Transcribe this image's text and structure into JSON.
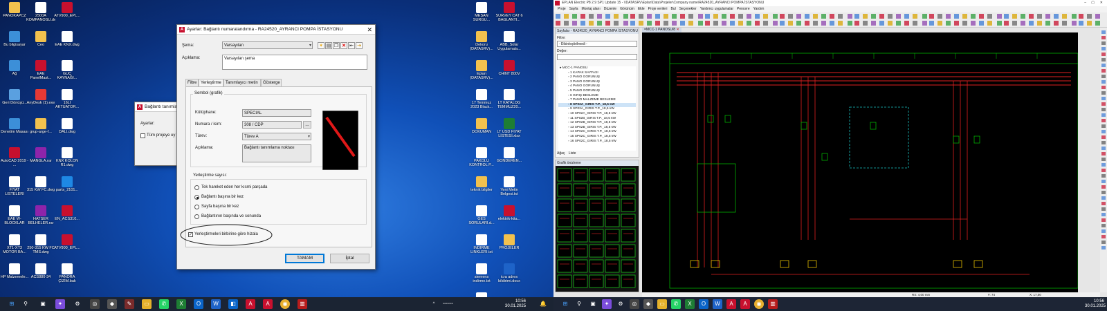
{
  "desktop_left": {
    "icons": [
      {
        "label": "PANOKAPCZ",
        "color": "#f2c14e"
      },
      {
        "label": "2500A KOMPANOSU.dwg",
        "color": "#ffffff"
      },
      {
        "label": "ATV900_EPL...",
        "color": "#c8102e"
      },
      {
        "label": "Bu bilgisayar",
        "color": "#3c8fd8"
      },
      {
        "label": "Ceo",
        "color": "#f2c14e"
      },
      {
        "label": "EAE KNX.dwg",
        "color": "#ffffff"
      },
      {
        "label": "Ağ",
        "color": "#3c8fd8"
      },
      {
        "label": "EAE PanelMast...",
        "color": "#c8102e"
      },
      {
        "label": "GÜÇ KAYNAĞI...",
        "color": "#ffffff"
      },
      {
        "label": "Geri Dönüşü...",
        "color": "#5aa0e0"
      },
      {
        "label": "AnyDesk (1).exe",
        "color": "#e53935"
      },
      {
        "label": "16LI AKTUATOR...",
        "color": "#ffffff"
      },
      {
        "label": "Denetim Masası",
        "color": "#3c8fd8"
      },
      {
        "label": "grup-arge-f...",
        "color": "#f2c14e"
      },
      {
        "label": "DALI.dwg",
        "color": "#ffffff"
      },
      {
        "label": "AutoCAD 2019 - ...",
        "color": "#c8102e"
      },
      {
        "label": "MANGLA.rar",
        "color": "#8e24aa"
      },
      {
        "label": "KNX KOLON R1.dwg",
        "color": "#ffffff"
      },
      {
        "label": "FIYAT LISTELERI",
        "color": "#ffffff"
      },
      {
        "label": "315 KW FC.dwg",
        "color": "#ffffff"
      },
      {
        "label": "parts_2101...",
        "color": "#1e88e5"
      },
      {
        "label": "EAE W-BLOCKLAR",
        "color": "#ffffff"
      },
      {
        "label": "HATSER BELHELER.rar",
        "color": "#8e24aa"
      },
      {
        "label": "EN_ACS310...",
        "color": "#c8102e"
      },
      {
        "label": "XT1-XT3 MOTOR BA...",
        "color": "#ffffff"
      },
      {
        "label": "250-315 KW FC TMS.dwg",
        "color": "#ffffff"
      },
      {
        "label": "ATV900_EPL...",
        "color": "#c8102e"
      },
      {
        "label": "HP Malzemele...",
        "color": "#ffffff"
      },
      {
        "label": "ACS880-34",
        "color": "#ffffff"
      },
      {
        "label": "PANORA ÇİZİM.bak",
        "color": "#ffffff"
      }
    ],
    "right_icons": [
      {
        "label": "MEŞAN SURGU...",
        "color": "#ffffff"
      },
      {
        "label": "SURVEY CAT 6 BAGLANTI...",
        "color": "#c8102e"
      },
      {
        "label": "Dekoru (DATASRV)...",
        "color": "#f2c14e"
      },
      {
        "label": "ABB_Solar Uygulamala...",
        "color": "#ffffff"
      },
      {
        "label": "Eplan (DATASRV)...",
        "color": "#f2c14e"
      },
      {
        "label": "CHINT 800V",
        "color": "#c8102e"
      },
      {
        "label": "17 Temmuz 2023 Black...",
        "color": "#ffffff"
      },
      {
        "label": "LT KATALOG TEMMUZ20...",
        "color": "#ffffff"
      },
      {
        "label": "DOKUMAN",
        "color": "#f2c14e"
      },
      {
        "label": "LT USD FIYAT LİSTESİ.xlsx",
        "color": "#1e7e34"
      },
      {
        "label": "PAKOLU KONTROL P...",
        "color": "#ffffff"
      },
      {
        "label": "GÖNDEREN...",
        "color": "#ffffff"
      },
      {
        "label": "teknik bilgiler",
        "color": "#f2c14e"
      },
      {
        "label": "Yeni Metin Belgesi.txt",
        "color": "#ffffff"
      },
      {
        "label": "GES SORULARI.d...",
        "color": "#ffffff"
      },
      {
        "label": "elektrik-kita...",
        "color": "#c8102e"
      },
      {
        "label": "INDIRME LINKLERI.txt",
        "color": "#ffffff"
      },
      {
        "label": "PROJELER",
        "color": "#f2c14e"
      },
      {
        "label": "siemens indirme.txt",
        "color": "#ffffff"
      },
      {
        "label": "icra adres bildirimi.docx",
        "color": "#1e63c8"
      },
      {
        "label": "dudukl...",
        "color": "#ffffff"
      }
    ]
  },
  "bg_dialog": {
    "title": "Bağlantı tanımla",
    "label": "Ayarlar:",
    "checkbox": "Tüm projeye uy"
  },
  "main_dialog": {
    "title": "Ayarlar: Bağlantı numaralandırma - RA24520_AYRANCI POMPA İSTASYONU",
    "schema_label": "Şema:",
    "schema_value": "Varsayılan",
    "desc_label": "Açıklama:",
    "desc_value": "Varsayılan şema",
    "tabs": [
      "Filtre",
      "Yerleştirme",
      "Tanımlayıcı metin",
      "Gösterge"
    ],
    "active_tab": 1,
    "symbol_group": "Sembol (grafik)",
    "library_label": "Kütüphane:",
    "library_value": "SPECIAL",
    "number_label": "Numara / isim:",
    "number_value": "308 / CDP",
    "variant_label": "Türev:",
    "variant_value": "Türev A",
    "sym_desc_label": "Açıklama:",
    "sym_desc_value": "Bağlantı tanımlama noktası",
    "count_group": "Yerleştirme sayısı:",
    "options": [
      "Tek hareket eden her kısmi parçada",
      "Bağlantı başına bir kez",
      "Sayfa başına bir kez",
      "Bağlantının başında ve sonunda"
    ],
    "selected_option": 1,
    "align_checkbox": "Yerleştirmeleri birbirine göre hizala",
    "ok": "TAMAM",
    "cancel": "İptal",
    "browse": "..."
  },
  "taskbar_left": {
    "time": "10:56",
    "date": "30.01.2025"
  },
  "eplan": {
    "title": "EPLAN Electric P8 2.9 SP1 Update 15 - \\\\DATASRV\\Eplan\\Data\\Projeler\\Company name\\RA24520_AYRANCI POMPA İSTASYONU",
    "menu": [
      "Proje",
      "Sayfa",
      "Montaj alanı",
      "Düzenle",
      "Görünüm",
      "Ekle",
      "Proje verileri",
      "Bul",
      "Seçenekler",
      "Yardımcı uygulamalar",
      "Pencere",
      "Yardım"
    ],
    "pages_panel_title": "Sayfalar - RA24520_AYRANCI POMPA İSTASYONU",
    "filter_label": "Filtre:",
    "filter_value": "- Etkinleştirilmedi -",
    "value_label": "Değer:",
    "tree_root": "MCC-1 PANOSU",
    "pages": [
      "1 KAPAK SAYFASI",
      "2 PANO GÖRÜNÜŞ",
      "3 PANO GÖRÜNÜŞ",
      "4 PANO GÖRÜNÜŞ",
      "5 PANO GÖRÜNÜŞ",
      "6 GİRİŞ BESLEME",
      "7 PANO MALZEME BESLEME",
      "8 SP02A_GIRIS T.P._18,5 kW",
      "9 SP02A_GIRIS T.P._18,5 kW",
      "10 SP02A_GIRIS T.P._18,5 kW",
      "11 SP02B_GIRIS T.P._18,5 kW",
      "12 SP02B_GIRIS T.P._18,5 kW",
      "13 SP02B_GIRIS T.P._18,5 kW",
      "14 SP02C_GIRIS T.P._18,5 kW",
      "15 SP02C_GIRIS T.P._18,5 kW",
      "16 SP02C_GIRIS T.P._18,5 kW"
    ],
    "selected_page": 7,
    "bottom_tabs": [
      "Ağaç",
      "Liste"
    ],
    "preview_title": "Grafik önizleme",
    "doc_tab": "=MCC-1 PANOSU/8",
    "status_left": "RX: 4,00 mm",
    "status_mid": "#: 74",
    "status_right": "X: 17,00",
    "time": "10:56",
    "date": "30.01.2025"
  },
  "colors": {
    "accent_red": "#c8102e",
    "wire_red": "#e02020",
    "wire_green": "#00b000",
    "canvas_bg": "#000000",
    "dialog_bg": "#f0f0f0"
  }
}
